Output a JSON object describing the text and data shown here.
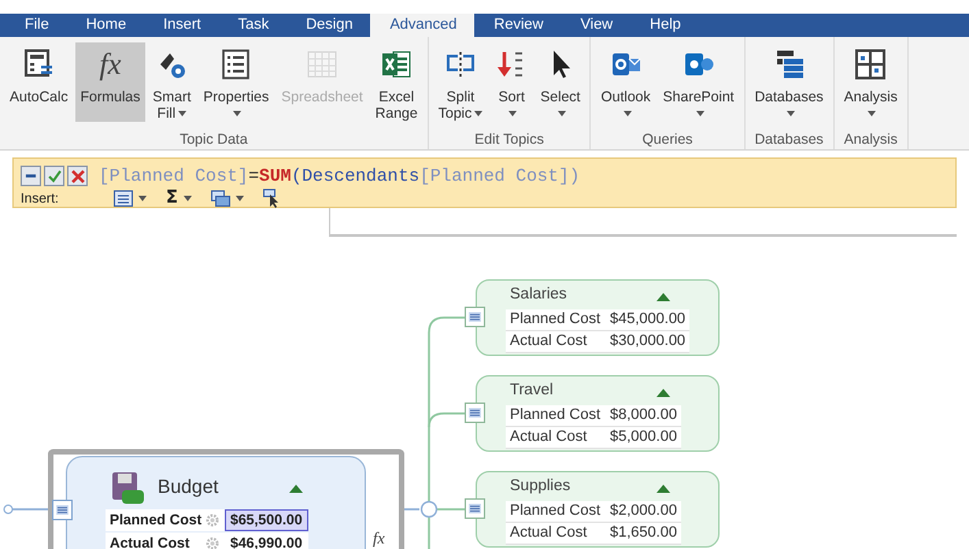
{
  "tabs": [
    {
      "label": "File",
      "selected": false
    },
    {
      "label": "Home",
      "selected": false
    },
    {
      "label": "Insert",
      "selected": false
    },
    {
      "label": "Task",
      "selected": false
    },
    {
      "label": "Design",
      "selected": false
    },
    {
      "label": "Advanced",
      "selected": true
    },
    {
      "label": "Review",
      "selected": false
    },
    {
      "label": "View",
      "selected": false
    },
    {
      "label": "Help",
      "selected": false
    }
  ],
  "ribbon": {
    "groups": [
      {
        "label": "Topic Data",
        "buttons": [
          {
            "kind": "autocalc",
            "lines": [
              "AutoCalc"
            ],
            "dropdown": false,
            "selected": false,
            "disabled": false
          },
          {
            "kind": "glyph",
            "glyph": "fx",
            "lines": [
              "Formulas"
            ],
            "dropdown": false,
            "selected": true,
            "disabled": false
          },
          {
            "kind": "smartfill",
            "lines": [
              "Smart",
              "Fill"
            ],
            "dropdown": true,
            "selected": false,
            "disabled": false
          },
          {
            "kind": "properties",
            "lines": [
              "Properties"
            ],
            "dropdown": true,
            "selected": false,
            "disabled": false
          },
          {
            "kind": "spreadsheet",
            "lines": [
              "Spreadsheet"
            ],
            "dropdown": false,
            "selected": false,
            "disabled": true
          },
          {
            "kind": "excel",
            "lines": [
              "Excel",
              "Range"
            ],
            "dropdown": false,
            "selected": false,
            "disabled": false
          }
        ]
      },
      {
        "label": "Edit Topics",
        "buttons": [
          {
            "kind": "split",
            "lines": [
              "Split",
              "Topic"
            ],
            "dropdown": true,
            "selected": false,
            "disabled": false
          },
          {
            "kind": "sort",
            "lines": [
              "Sort"
            ],
            "dropdown": true,
            "selected": false,
            "disabled": false
          },
          {
            "kind": "select",
            "lines": [
              "Select"
            ],
            "dropdown": true,
            "selected": false,
            "disabled": false
          }
        ]
      },
      {
        "label": "Queries",
        "buttons": [
          {
            "kind": "outlook",
            "lines": [
              "Outlook"
            ],
            "dropdown": true,
            "selected": false,
            "disabled": false
          },
          {
            "kind": "sharepoint",
            "lines": [
              "SharePoint"
            ],
            "dropdown": true,
            "selected": false,
            "disabled": false
          }
        ]
      },
      {
        "label": "Databases",
        "buttons": [
          {
            "kind": "databases",
            "lines": [
              "Databases"
            ],
            "dropdown": true,
            "selected": false,
            "disabled": false
          }
        ]
      },
      {
        "label": "Analysis",
        "buttons": [
          {
            "kind": "analysis",
            "lines": [
              "Analysis"
            ],
            "dropdown": true,
            "selected": false,
            "disabled": false
          }
        ]
      }
    ]
  },
  "formula_bar": {
    "formula": [
      {
        "kind": "field",
        "text": "[Planned Cost]"
      },
      {
        "kind": "operator",
        "text": "="
      },
      {
        "kind": "function",
        "text": "SUM"
      },
      {
        "kind": "name",
        "text": "(Descendants"
      },
      {
        "kind": "field",
        "text": "[Planned Cost])"
      }
    ],
    "insert_label": "Insert:",
    "insert_tools": [
      {
        "kind": "fields",
        "dropdown": true
      },
      {
        "kind": "sum",
        "glyph": "Σ",
        "dropdown": true
      },
      {
        "kind": "window",
        "dropdown": true
      },
      {
        "kind": "pointer",
        "dropdown": false
      }
    ]
  },
  "map": {
    "root": {
      "title": "Budget",
      "selected": true,
      "formula_mark": "fx",
      "properties": [
        {
          "name": "Planned Cost",
          "value": "$65,500.00",
          "computed": true,
          "selected": true
        },
        {
          "name": "Actual Cost",
          "value": "$46,990.00",
          "computed": true,
          "selected": false
        }
      ],
      "children": [
        {
          "title": "Salaries",
          "properties": [
            {
              "name": "Planned Cost",
              "value": "$45,000.00",
              "selected": false
            },
            {
              "name": "Actual Cost",
              "value": "$30,000.00",
              "selected": false
            }
          ]
        },
        {
          "title": "Travel",
          "properties": [
            {
              "name": "Planned Cost",
              "value": "$8,000.00",
              "selected": false
            },
            {
              "name": "Actual Cost",
              "value": "$5,000.00",
              "selected": false
            }
          ]
        },
        {
          "title": "Supplies",
          "properties": [
            {
              "name": "Planned Cost",
              "value": "$2,000.00",
              "selected": false
            },
            {
              "name": "Actual Cost",
              "value": "$1,650.00",
              "selected": false
            }
          ]
        }
      ]
    }
  }
}
